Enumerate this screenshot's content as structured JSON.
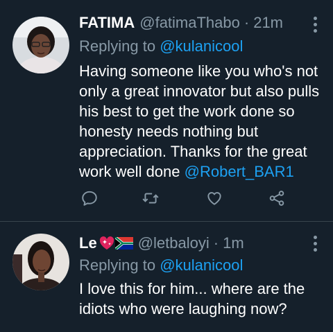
{
  "tweets": [
    {
      "name": "FATIMA",
      "handle": "@fatimaThabo",
      "time": "21m",
      "replying_prefix": "Replying to",
      "replying_to": "@kulanicool",
      "text": "Having someone like you who's not only a great innovator but also pulls his best to get the work done so honesty needs nothing but appreciation. Thanks for the great work well done ",
      "text_mention": "@Robert_BAR1"
    },
    {
      "name": "Le",
      "name_emojis": [
        "sparkling-heart",
        "south-africa-flag"
      ],
      "handle": "@letbaloyi",
      "time": "1m",
      "replying_prefix": "Replying to",
      "replying_to": "@kulanicool",
      "text": "I love this for him... where are the idiots who were laughing now?"
    }
  ],
  "separator": "·",
  "colors": {
    "background": "#15202b",
    "text": "#ffffff",
    "secondary": "#8899a6",
    "link": "#1da1f2",
    "divider": "#38444d"
  },
  "icons": [
    "reply-icon",
    "retweet-icon",
    "like-icon",
    "share-icon",
    "more-options-icon"
  ]
}
